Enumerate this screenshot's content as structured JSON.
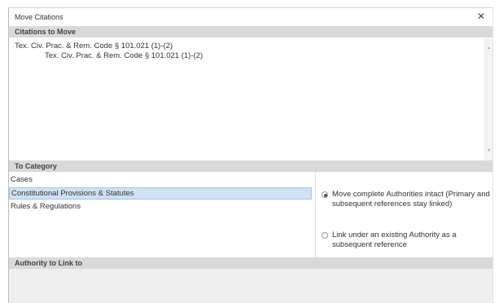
{
  "window": {
    "title": "Move Citations",
    "close_glyph": "✕"
  },
  "citations_section": {
    "header": "Citations to Move",
    "lines": [
      "Tex. Civ. Prac. & Rem. Code § 101.021 (1)-(2)",
      "Tex. Civ. Prac. & Rem. Code § 101.021 (1)-(2)"
    ]
  },
  "category_section": {
    "header": "To Category",
    "items": [
      {
        "label": "Cases",
        "selected": false
      },
      {
        "label": "Constitutional Provisions & Statutes",
        "selected": true
      },
      {
        "label": "Rules & Regulations",
        "selected": false
      }
    ]
  },
  "link_options": [
    {
      "label": "Move complete Authorities intact (Primary and subsequent references stay linked)",
      "checked": true
    },
    {
      "label": "Link under an existing Authority as a subsequent reference",
      "checked": false
    }
  ],
  "authority_section": {
    "header": "Authority to Link to"
  },
  "icons": {
    "scroll_up": "▲",
    "scroll_down": "▼"
  },
  "colors": {
    "section_header_bg": "#d9d9d9",
    "selected_item_bg": "#cfe1f5",
    "selected_item_border": "#a7c5e8"
  }
}
